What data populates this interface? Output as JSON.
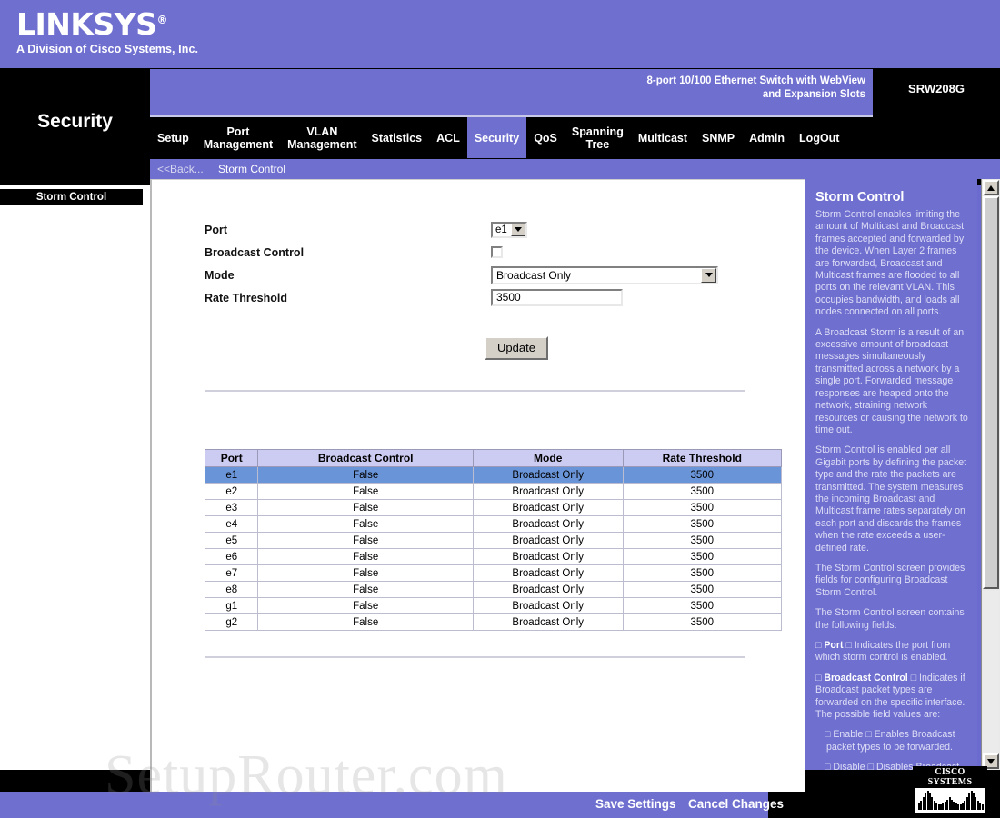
{
  "brand": {
    "name": "LINKSYS",
    "registered": "®",
    "tagline": "A Division of Cisco Systems, Inc."
  },
  "header": {
    "section_title": "Security",
    "product_description_line1": "8-port 10/100 Ethernet Switch with WebView",
    "product_description_line2": "and Expansion Slots",
    "model": "SRW208G"
  },
  "nav": {
    "items": [
      {
        "label": "Setup",
        "active": false
      },
      {
        "label": "Port\nManagement",
        "active": false
      },
      {
        "label": "VLAN\nManagement",
        "active": false
      },
      {
        "label": "Statistics",
        "active": false
      },
      {
        "label": "ACL",
        "active": false
      },
      {
        "label": "Security",
        "active": true
      },
      {
        "label": "QoS",
        "active": false
      },
      {
        "label": "Spanning\nTree",
        "active": false
      },
      {
        "label": "Multicast",
        "active": false
      },
      {
        "label": "SNMP",
        "active": false
      },
      {
        "label": "Admin",
        "active": false
      },
      {
        "label": "LogOut",
        "active": false
      }
    ]
  },
  "breadcrumb": {
    "back": "<<Back...",
    "current": "Storm Control"
  },
  "sidebar": {
    "items": [
      {
        "label": "Storm Control",
        "active": true
      }
    ]
  },
  "form": {
    "port": {
      "label": "Port",
      "value": "e1"
    },
    "broadcast_control": {
      "label": "Broadcast Control",
      "checked": false
    },
    "mode": {
      "label": "Mode",
      "value": "Broadcast Only"
    },
    "rate_threshold": {
      "label": "Rate Threshold",
      "value": "3500"
    },
    "update_button": "Update"
  },
  "table": {
    "columns": [
      "Port",
      "Broadcast Control",
      "Mode",
      "Rate Threshold"
    ],
    "rows": [
      {
        "port": "e1",
        "broadcast_control": "False",
        "mode": "Broadcast Only",
        "rate_threshold": "3500",
        "selected": true
      },
      {
        "port": "e2",
        "broadcast_control": "False",
        "mode": "Broadcast Only",
        "rate_threshold": "3500",
        "selected": false
      },
      {
        "port": "e3",
        "broadcast_control": "False",
        "mode": "Broadcast Only",
        "rate_threshold": "3500",
        "selected": false
      },
      {
        "port": "e4",
        "broadcast_control": "False",
        "mode": "Broadcast Only",
        "rate_threshold": "3500",
        "selected": false
      },
      {
        "port": "e5",
        "broadcast_control": "False",
        "mode": "Broadcast Only",
        "rate_threshold": "3500",
        "selected": false
      },
      {
        "port": "e6",
        "broadcast_control": "False",
        "mode": "Broadcast Only",
        "rate_threshold": "3500",
        "selected": false
      },
      {
        "port": "e7",
        "broadcast_control": "False",
        "mode": "Broadcast Only",
        "rate_threshold": "3500",
        "selected": false
      },
      {
        "port": "e8",
        "broadcast_control": "False",
        "mode": "Broadcast Only",
        "rate_threshold": "3500",
        "selected": false
      },
      {
        "port": "g1",
        "broadcast_control": "False",
        "mode": "Broadcast Only",
        "rate_threshold": "3500",
        "selected": false
      },
      {
        "port": "g2",
        "broadcast_control": "False",
        "mode": "Broadcast Only",
        "rate_threshold": "3500",
        "selected": false
      }
    ]
  },
  "help": {
    "title": "Storm Control",
    "paragraphs": [
      {
        "text": "Storm Control enables limiting the amount of Multicast and Broadcast frames accepted and forwarded by the device. When Layer 2 frames are forwarded, Broadcast and Multicast frames are flooded to all ports on the relevant VLAN. This occupies bandwidth, and loads all nodes connected on all ports.",
        "indent": false
      },
      {
        "text": "A Broadcast Storm is a result of an excessive amount of broadcast messages simultaneously transmitted across a network by a single port. Forwarded message responses are heaped onto the network, straining network resources or causing the network to time out.",
        "indent": false
      },
      {
        "text": "Storm Control is enabled per all Gigabit ports by defining the packet type and the rate the packets are transmitted. The system measures the incoming Broadcast and Multicast frame rates separately on each port and discards the frames when the rate exceeds a user-defined rate.",
        "indent": false
      },
      {
        "text": "The Storm Control screen provides fields for configuring Broadcast Storm Control.",
        "indent": false
      },
      {
        "text": "The Storm Control screen contains the following fields:",
        "indent": false
      },
      {
        "text": "□ Port □ Indicates the port from which storm control is enabled.",
        "indent": false,
        "bold_head": "Port"
      },
      {
        "text": "□ Broadcast Control □ Indicates if Broadcast packet types are forwarded on the specific interface. The possible field values are:",
        "indent": false,
        "bold_head": "Broadcast Control"
      },
      {
        "text": "□ Enable □ Enables Broadcast packet types to be forwarded.",
        "indent": true
      },
      {
        "text": "□ Disable □ Disables Broadcast",
        "indent": true
      }
    ]
  },
  "footer": {
    "save": "Save Settings",
    "cancel": "Cancel Changes",
    "cisco_logo_text": "CISCO SYSTEMS"
  },
  "watermark": {
    "text": "SetupRouter.com"
  },
  "colors": {
    "brand_purple": "#6f6fd0",
    "nav_black": "#000000",
    "table_header": "#ccccf2",
    "row_selected": "#6a94d8",
    "help_text": "#dedef6"
  }
}
